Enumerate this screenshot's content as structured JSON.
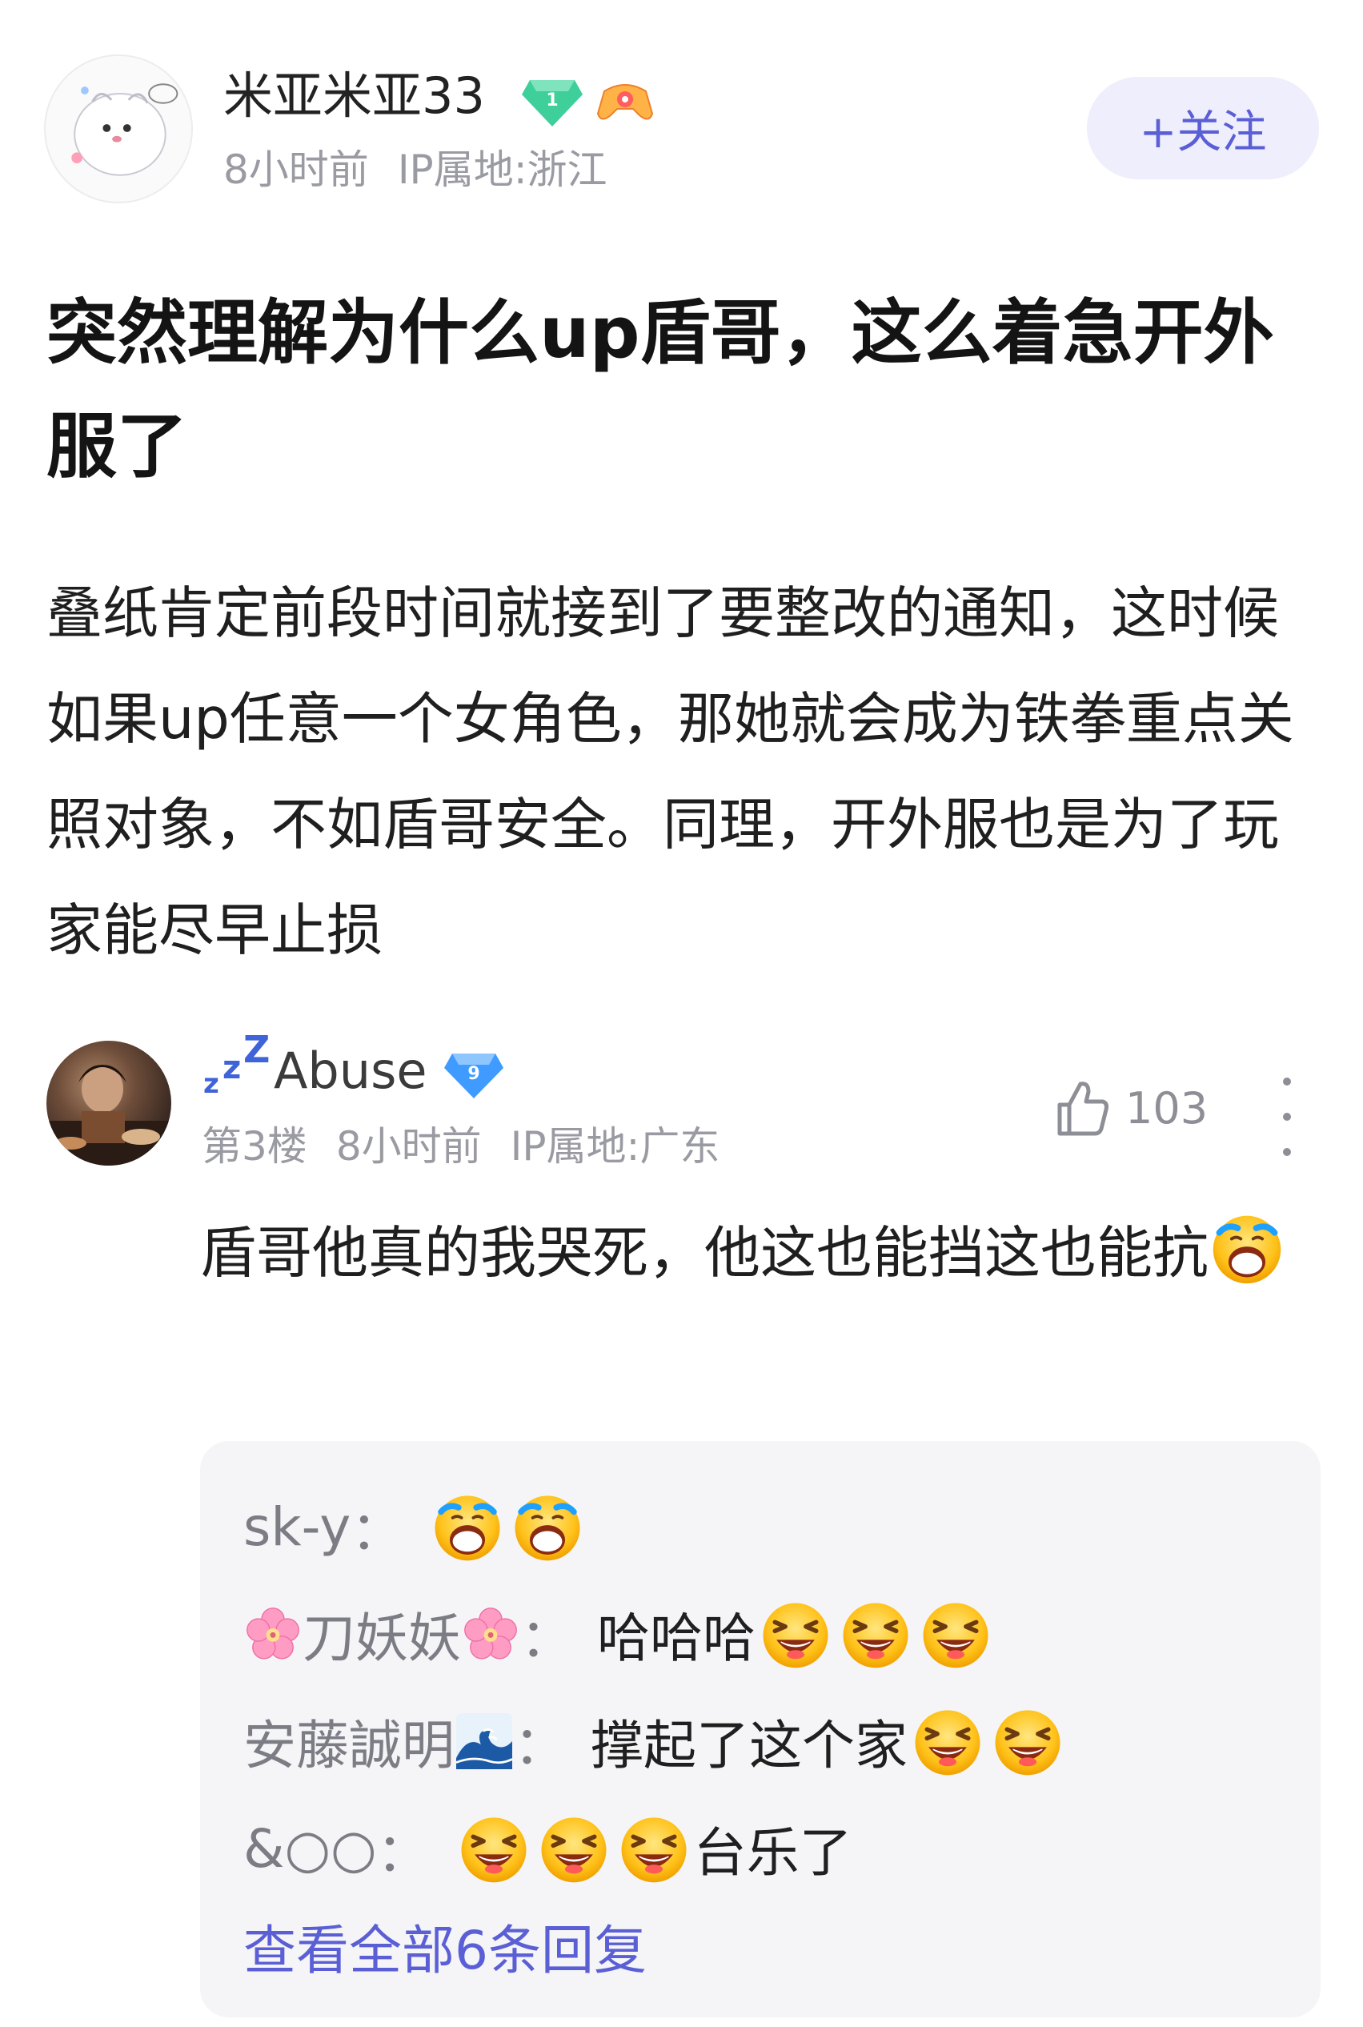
{
  "post": {
    "author": {
      "name": "米亚米亚33",
      "level_badge": "1",
      "time": "8小时前",
      "location": "IP属地:浙江"
    },
    "follow_label": "+关注",
    "title": "突然理解为什么up盾哥，这么着急开外服了",
    "body": "叠纸肯定前段时间就接到了要整改的通知，这时候如果up任意一个女角色，那她就会成为铁拳重点关照对象，不如盾哥安全。同理，开外服也是为了玩家能尽早止损"
  },
  "comment": {
    "user": "Abuse",
    "level_badge": "9",
    "floor": "第3楼",
    "time": "8小时前",
    "location": "IP属地:广东",
    "likes": "103",
    "text": "盾哥他真的我哭死，他这也能挡这也能抗",
    "replies": [
      {
        "name": "sk-y",
        "colon": "：",
        "text": ""
      },
      {
        "name": "刀妖妖",
        "colon": "：",
        "text": "哈哈哈"
      },
      {
        "name": "安藤誠明",
        "colon": "：",
        "text": "撑起了这个家"
      },
      {
        "name": "&○○",
        "colon": "：",
        "text": "台乐了"
      }
    ],
    "view_all": "查看全部6条回复"
  },
  "colors": {
    "accent": "#5b5fd6",
    "meta_gray": "#9a9aa2",
    "reply_bg": "#f5f5f7",
    "follow_bg": "#eeeefc"
  },
  "icons": [
    "avatar",
    "diamond-level-icon",
    "gamepad-badge-icon",
    "zzz-icon",
    "thumbs-up-icon",
    "more-vertical-icon",
    "crying-emoji",
    "laughing-emoji",
    "cherry-blossom-icon",
    "wave-icon"
  ]
}
